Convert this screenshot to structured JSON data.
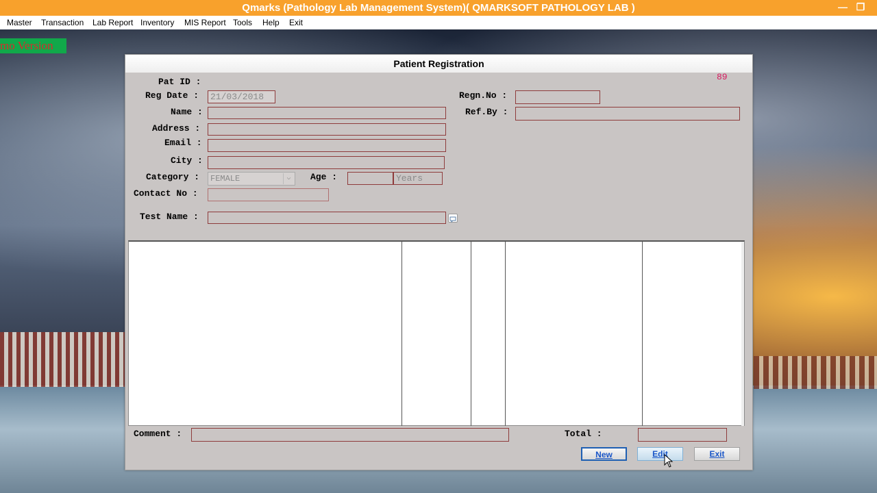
{
  "window": {
    "title": "Qmarks (Pathology Lab Management System)( QMARKSOFT PATHOLOGY LAB )",
    "minimize_glyph": "—",
    "restore_glyph": "❐"
  },
  "menu": [
    "Master",
    "Transaction",
    "Lab Report",
    "Inventory",
    "MIS Report",
    "Tools",
    "Help",
    "Exit"
  ],
  "badge": {
    "text": "mo Version"
  },
  "dialog": {
    "title": "Patient Registration",
    "counter": "89",
    "labels": {
      "pat_id": "Pat ID :",
      "reg_date": "Reg Date :",
      "name": "Name :",
      "address": "Address :",
      "email": "Email :",
      "city": "City :",
      "category": "Category :",
      "age": "Age :",
      "contact_no": "Contact No :",
      "test_name": "Test Name :",
      "regn_no": "Regn.No :",
      "ref_by": "Ref.By :",
      "comment": "Comment :",
      "total": "Total :"
    },
    "values": {
      "reg_date": "21/03/2018",
      "category": "FEMALE",
      "age_unit": "Years",
      "name": "",
      "address": "",
      "email": "",
      "city": "",
      "age": "",
      "contact_no": "",
      "test_name": "",
      "regn_no": "",
      "ref_by": "",
      "comment": "",
      "total": ""
    },
    "buttons": {
      "new": "New",
      "edit": "Edit",
      "exit": "Exit"
    }
  },
  "colors": {
    "titlebar": "#f8a12c",
    "dialog_bg": "#c9c5c4",
    "field_border": "#8e3b3b",
    "button_text": "#1a56c8",
    "counter": "#d81b60"
  },
  "icons": {
    "dropdown": "chevron-down-icon",
    "test_lookup": "comment-icon",
    "cursor": "mouse-pointer-icon"
  }
}
